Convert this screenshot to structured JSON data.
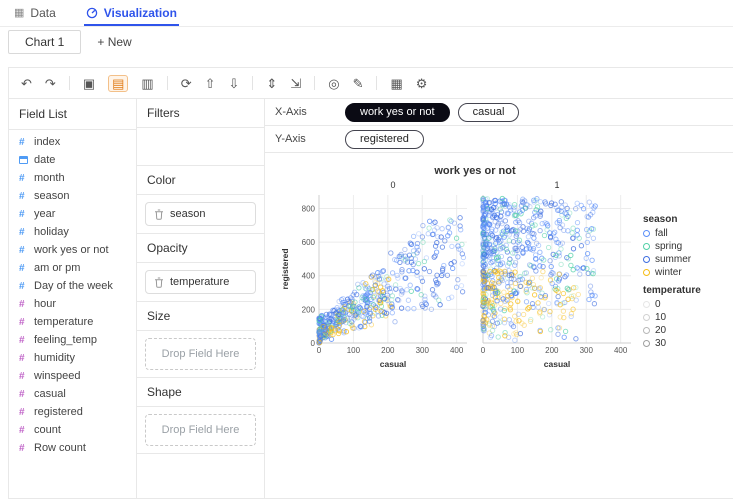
{
  "colors": {
    "accent": "#2f54eb",
    "dimension": "#4f9bf5",
    "measure": "#c166c9",
    "toolbar_highlight": "#e07b16",
    "pill_solid": "#0b0b14"
  },
  "tabs": {
    "data": "Data",
    "visualization": "Visualization"
  },
  "chart_tabs": {
    "chart1": "Chart 1",
    "new_label": "+ New"
  },
  "toolbar": {
    "items": [
      {
        "name": "undo",
        "glyph": "↶"
      },
      {
        "name": "redo",
        "glyph": "↷"
      },
      {
        "sep": true
      },
      {
        "name": "mark-type",
        "glyph": "▣"
      },
      {
        "name": "encoding-edit",
        "glyph": "▤",
        "active": true
      },
      {
        "name": "layers",
        "glyph": "▥"
      },
      {
        "sep": true
      },
      {
        "name": "refresh",
        "glyph": "⟳"
      },
      {
        "name": "sort-ascending",
        "glyph": "⇧"
      },
      {
        "name": "sort-descending",
        "glyph": "⇩"
      },
      {
        "sep": true
      },
      {
        "name": "transpose",
        "glyph": "⇕"
      },
      {
        "name": "resize-mode",
        "glyph": "⇲"
      },
      {
        "sep": true
      },
      {
        "name": "zoom-mode",
        "glyph": "◎"
      },
      {
        "name": "brush",
        "glyph": "✎"
      },
      {
        "sep": true
      },
      {
        "name": "export-image",
        "glyph": "▦"
      },
      {
        "name": "config",
        "glyph": "⚙"
      }
    ]
  },
  "field_list": {
    "title": "Field List",
    "items": [
      {
        "name": "index",
        "type": "dimension",
        "icon": "hash"
      },
      {
        "name": "date",
        "type": "dimension",
        "icon": "calendar"
      },
      {
        "name": "month",
        "type": "dimension",
        "icon": "hash"
      },
      {
        "name": "season",
        "type": "dimension",
        "icon": "hash"
      },
      {
        "name": "year",
        "type": "dimension",
        "icon": "hash"
      },
      {
        "name": "holiday",
        "type": "dimension",
        "icon": "hash"
      },
      {
        "name": "work yes or not",
        "type": "dimension",
        "icon": "hash"
      },
      {
        "name": "am or pm",
        "type": "dimension",
        "icon": "hash"
      },
      {
        "name": "Day of the week",
        "type": "dimension",
        "icon": "hash"
      },
      {
        "name": "hour",
        "type": "measure",
        "icon": "hash"
      },
      {
        "name": "temperature",
        "type": "measure",
        "icon": "hash"
      },
      {
        "name": "feeling_temp",
        "type": "measure",
        "icon": "hash"
      },
      {
        "name": "humidity",
        "type": "measure",
        "icon": "hash"
      },
      {
        "name": "winspeed",
        "type": "measure",
        "icon": "hash"
      },
      {
        "name": "casual",
        "type": "measure",
        "icon": "hash"
      },
      {
        "name": "registered",
        "type": "measure",
        "icon": "hash"
      },
      {
        "name": "count",
        "type": "measure",
        "icon": "hash"
      },
      {
        "name": "Row count",
        "type": "measure",
        "icon": "hash"
      }
    ]
  },
  "encodings": {
    "filters_label": "Filters",
    "color": {
      "label": "Color",
      "field": "season"
    },
    "opacity": {
      "label": "Opacity",
      "field": "temperature"
    },
    "size": {
      "label": "Size",
      "placeholder": "Drop Field Here"
    },
    "shape": {
      "label": "Shape",
      "placeholder": "Drop Field Here"
    }
  },
  "axes": {
    "x_label": "X-Axis",
    "x_fields": [
      {
        "name": "work yes or not",
        "style": "solid"
      },
      {
        "name": "casual",
        "style": "outline"
      }
    ],
    "y_label": "Y-Axis",
    "y_fields": [
      {
        "name": "registered",
        "style": "outline"
      }
    ]
  },
  "chart_data": {
    "type": "scatter",
    "title": "work yes or not",
    "facet": {
      "field": "work yes or not",
      "values": [
        "0",
        "1"
      ]
    },
    "x": {
      "label": "casual",
      "domain": [
        0,
        400
      ],
      "ticks": [
        0,
        100,
        200,
        300,
        400
      ]
    },
    "y": {
      "label": "registered",
      "domain": [
        0,
        800
      ],
      "ticks": [
        0,
        200,
        400,
        600,
        800
      ]
    },
    "mark": {
      "type": "circle",
      "style": "hollow",
      "radius": 2.2
    },
    "grid": true,
    "legend_position": "right",
    "legends": [
      {
        "title": "season",
        "channel": "color",
        "entries": [
          {
            "label": "fall",
            "color": "#5B8FF9"
          },
          {
            "label": "spring",
            "color": "#50D0A6"
          },
          {
            "label": "summer",
            "color": "#3D6DE0"
          },
          {
            "label": "winter",
            "color": "#F6BD16"
          }
        ]
      },
      {
        "title": "temperature",
        "channel": "opacity",
        "entries": [
          {
            "label": "0",
            "opacity": 0.25
          },
          {
            "label": "10",
            "opacity": 0.45
          },
          {
            "label": "20",
            "opacity": 0.7
          },
          {
            "label": "30",
            "opacity": 0.95
          }
        ]
      }
    ],
    "point_cloud": {
      "seed": 7,
      "season_weights": [
        0.36,
        0.16,
        0.28,
        0.2
      ],
      "facets": [
        {
          "value": "0",
          "count": 550,
          "shape": "fan",
          "x_max": 420,
          "y_max": 760
        },
        {
          "value": "1",
          "count": 780,
          "shape": "column",
          "x_max": 330,
          "y_max": 860
        }
      ]
    }
  }
}
